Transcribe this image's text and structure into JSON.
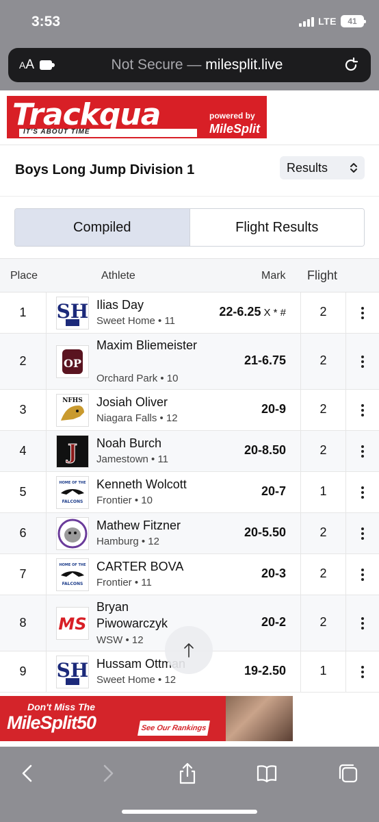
{
  "status_bar": {
    "time": "3:53",
    "network": "LTE",
    "battery": "41"
  },
  "browser": {
    "aa_label": "AA",
    "url_prefix": "Not Secure — ",
    "url_host": "milesplit.live"
  },
  "header": {
    "logo_text": "Trackqua",
    "logo_tagline": "IT'S ABOUT TIME",
    "powered_by": "powered by",
    "powered_brand": "MileSplit"
  },
  "event": {
    "title": "Boys Long Jump Division 1",
    "select_value": "Results"
  },
  "toggle": {
    "compiled": "Compiled",
    "flight_results": "Flight Results"
  },
  "table": {
    "headers": {
      "place": "Place",
      "athlete": "Athlete",
      "mark": "Mark",
      "flight": "Flight"
    },
    "rows": [
      {
        "place": "1",
        "name": "Ilias Day",
        "team": "Sweet Home • 11",
        "mark": "22-6.25",
        "flags": "X * #",
        "flight": "2",
        "logo": "sweet-home-logo"
      },
      {
        "place": "2",
        "name": "Maxim Bliemeister",
        "team": "Orchard Park • 10",
        "mark": "21-6.75",
        "flags": "",
        "flight": "2",
        "logo": "orchard-park-logo"
      },
      {
        "place": "3",
        "name": "Josiah Oliver",
        "team": "Niagara Falls • 12",
        "mark": "20-9",
        "flags": "",
        "flight": "2",
        "logo": "niagara-falls-logo"
      },
      {
        "place": "4",
        "name": "Noah Burch",
        "team": "Jamestown • 11",
        "mark": "20-8.50",
        "flags": "",
        "flight": "2",
        "logo": "jamestown-logo"
      },
      {
        "place": "5",
        "name": "Kenneth Wolcott",
        "team": "Frontier • 10",
        "mark": "20-7",
        "flags": "",
        "flight": "1",
        "logo": "frontier-logo"
      },
      {
        "place": "6",
        "name": "Mathew Fitzner",
        "team": "Hamburg • 12",
        "mark": "20-5.50",
        "flags": "",
        "flight": "2",
        "logo": "hamburg-logo"
      },
      {
        "place": "7",
        "name": "CARTER BOVA",
        "team": "Frontier • 11",
        "mark": "20-3",
        "flags": "",
        "flight": "2",
        "logo": "frontier-logo"
      },
      {
        "place": "8",
        "name": "Bryan Piwowarczyk",
        "team": "WSW • 12",
        "mark": "20-2",
        "flags": "",
        "flight": "2",
        "logo": "wsw-logo"
      },
      {
        "place": "9",
        "name": "Hussam Ottman",
        "team": "Sweet Home • 12",
        "mark": "19-2.50",
        "flags": "",
        "flight": "1",
        "logo": "sweet-home-logo"
      }
    ]
  },
  "ad": {
    "line1": "Don't Miss The",
    "line2": "MileSplit50",
    "cta": "See Our Rankings"
  },
  "logo_text": {
    "sweet_home": "SH",
    "orchard_park": "OP",
    "niagara": "NFHS",
    "jamestown": "J",
    "frontier_top": "HOME OF THE",
    "frontier_bottom": "FALCONS",
    "wsw": "MS"
  },
  "colors": {
    "brand_red": "#d81f26",
    "chrome_gray": "#8e8e93",
    "toggle_active": "#dde2ee"
  }
}
